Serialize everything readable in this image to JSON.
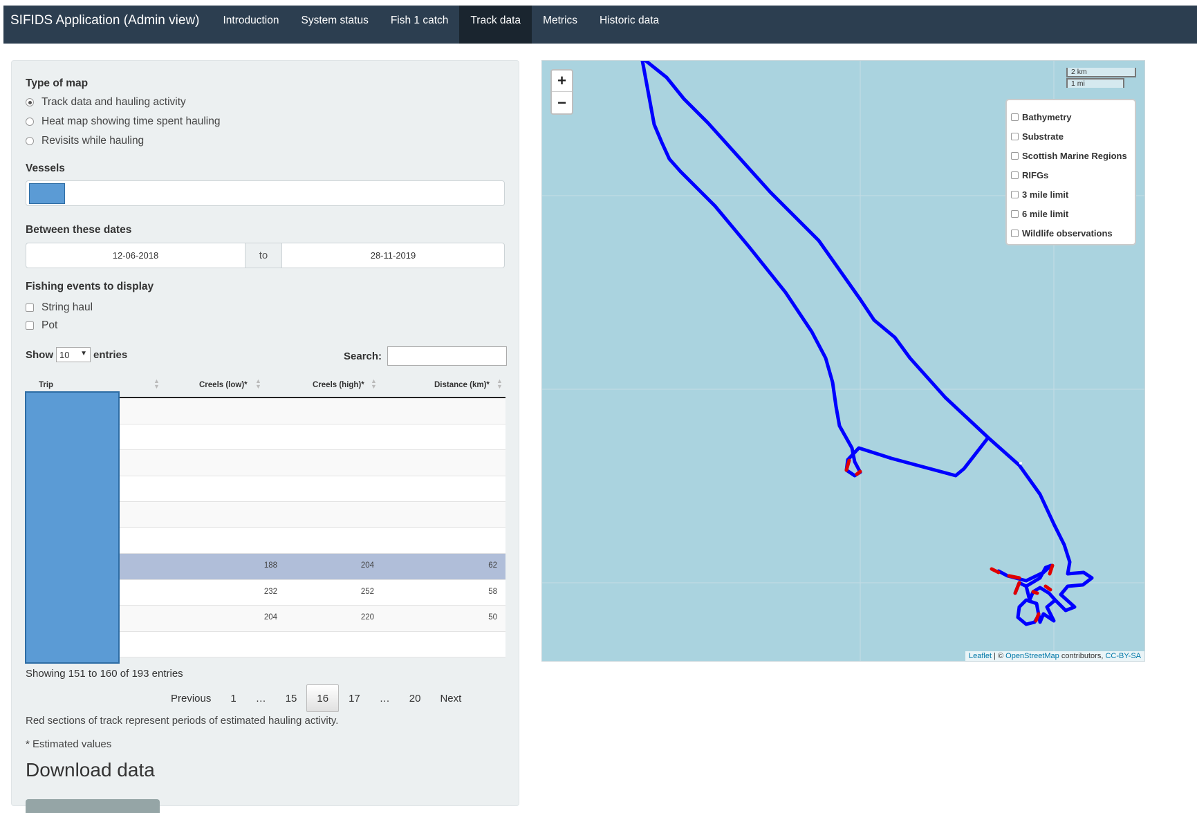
{
  "navbar": {
    "brand": "SIFIDS Application (Admin view)",
    "tabs": [
      "Introduction",
      "System status",
      "Fish 1 catch",
      "Track data",
      "Metrics",
      "Historic data"
    ],
    "active_tab": "Track data"
  },
  "sidebar": {
    "map_type_label": "Type of map",
    "map_types": [
      {
        "label": "Track data and hauling activity",
        "selected": true
      },
      {
        "label": "Heat map showing time spent hauling",
        "selected": false
      },
      {
        "label": "Revisits while hauling",
        "selected": false
      }
    ],
    "vessels_label": "Vessels",
    "dates_label": "Between these dates",
    "date_from": "12-06-2018",
    "date_sep": "to",
    "date_to": "28-11-2019",
    "events_label": "Fishing events to display",
    "events": [
      {
        "label": "String haul",
        "checked": false
      },
      {
        "label": "Pot",
        "checked": false
      }
    ],
    "show_label": "Show",
    "show_value": "10",
    "entries_label": "entries",
    "search_label": "Search:",
    "table": {
      "columns": [
        "Trip",
        "Creels (low)*",
        "Creels (high)*",
        "Distance (km)*"
      ],
      "rows": [
        [
          "",
          "",
          "",
          ""
        ],
        [
          "",
          "",
          "",
          ""
        ],
        [
          "",
          "",
          "",
          ""
        ],
        [
          "",
          "",
          "",
          ""
        ],
        [
          "",
          "",
          "",
          ""
        ],
        [
          "",
          "",
          "",
          ""
        ],
        [
          "",
          "188",
          "204",
          "62"
        ],
        [
          "",
          "232",
          "252",
          "58"
        ],
        [
          "",
          "204",
          "220",
          "50"
        ],
        [
          "",
          "",
          "",
          ""
        ]
      ],
      "selected_row": 6
    },
    "info": "Showing 151 to 160 of 193 entries",
    "pagination": [
      "Previous",
      "1",
      "…",
      "15",
      "16",
      "17",
      "…",
      "20",
      "Next"
    ],
    "current_page": "16",
    "note_red": "Red sections of track represent periods of estimated hauling activity.",
    "note_est": "* Estimated values",
    "download_title": "Download data"
  },
  "map": {
    "zoom_in": "+",
    "zoom_out": "−",
    "scale_km": "2 km",
    "scale_mi": "1 mi",
    "layers": [
      "Bathymetry",
      "Substrate",
      "Scottish Marine Regions",
      "RIFGs",
      "3 mile limit",
      "6 mile limit",
      "Wildlife observations"
    ],
    "attribution_leaflet": "Leaflet",
    "attribution_sep": " | © ",
    "attribution_osm": "OpenStreetMap",
    "attribution_mid": " contributors, ",
    "attribution_license": "CC-BY-SA",
    "track_color": "#0000ff",
    "haul_color": "#e00000",
    "sea_color": "#aad3df"
  }
}
